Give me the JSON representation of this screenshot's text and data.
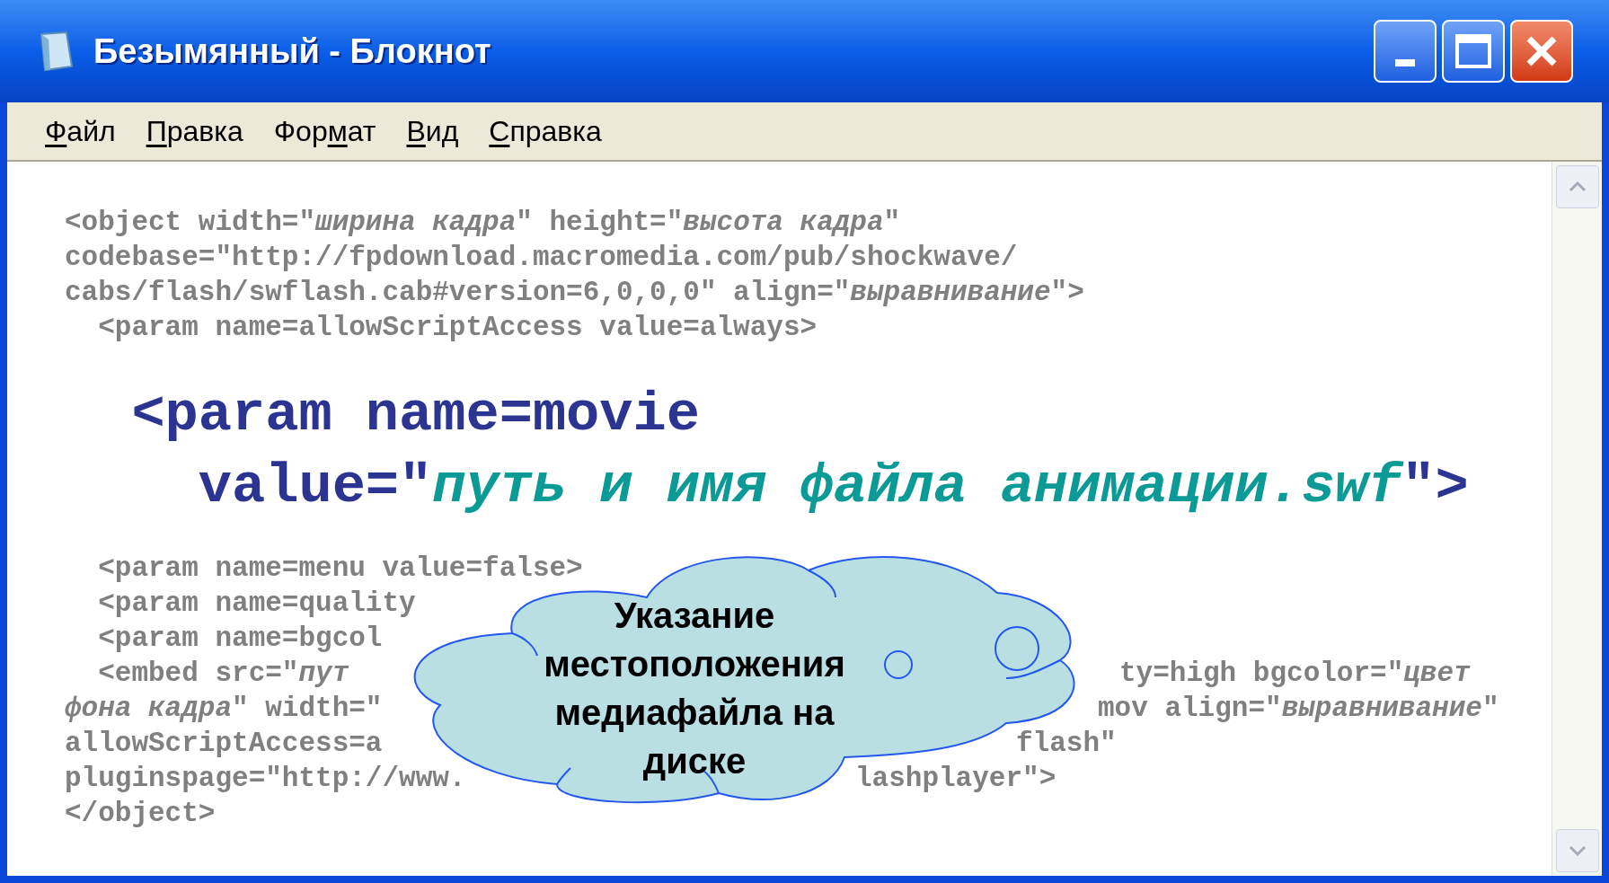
{
  "window": {
    "title": "Безымянный - Блокнот"
  },
  "menu": [
    {
      "key": "Ф",
      "after": "айл"
    },
    {
      "key": "П",
      "after": "равка"
    },
    {
      "before": "Фор",
      "key": "м",
      "after": "ат"
    },
    {
      "key": "В",
      "after": "ид"
    },
    {
      "key": "С",
      "after": "правка"
    }
  ],
  "lines": [
    {
      "kind": "code",
      "text": "<object width=\"*ширина кадра*\" height=\"*высота кадра*\""
    },
    {
      "kind": "code",
      "text": "codebase=\"http://fpdownload.macromedia.com/pub/shockwave/"
    },
    {
      "kind": "code",
      "text": "cabs/flash/swflash.cab#version=6,0,0,0\" align=\"*выравнивание*\">"
    },
    {
      "kind": "code",
      "text": "  <param name=allowScriptAccess value=always>"
    },
    {
      "kind": "large",
      "text": "  <param name=movie"
    },
    {
      "kind": "large",
      "text": "    value=\"*путь и имя файла анимации.swf*\">"
    },
    {
      "kind": "code",
      "text": "  <param name=menu value=false>"
    },
    {
      "kind": "code",
      "text": "  <param name=quality"
    },
    {
      "kind": "code",
      "text": "  <param name=bgcol"
    },
    {
      "kind": "code",
      "text": "  <embed src=\"*пут*",
      "right": "ty=high bgcolor=\"*цвет*"
    },
    {
      "kind": "code",
      "text": "*фона кадра*\" width=\"",
      "right": "mov align=\"*выравнивание*\""
    },
    {
      "kind": "code",
      "text": "allowScriptAccess=a",
      "right": "flash\""
    },
    {
      "kind": "code",
      "text": "pluginspage=\"http://www.",
      "right": "lashplayer\">"
    },
    {
      "kind": "code",
      "text": "</object>"
    }
  ],
  "callout": {
    "text": "Указание местоположения медиафайла на диске"
  }
}
